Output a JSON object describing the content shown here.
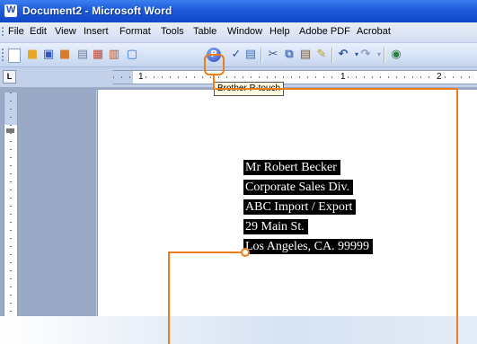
{
  "window": {
    "title": "Document2 - Microsoft Word"
  },
  "menu": [
    "File",
    "Edit",
    "View",
    "Insert",
    "Format",
    "Tools",
    "Table",
    "Window",
    "Help",
    "Adobe PDF",
    "Acrobat"
  ],
  "toolbar": {
    "icons": [
      "new-doc-icon",
      "open-icon",
      "save-icon",
      "permission-icon",
      "print-icon",
      "print-preview-icon",
      "research-icon",
      "brother-ptouch-icon",
      "spelling-icon",
      "research-book-icon",
      "cut-icon",
      "copy-icon",
      "paste-icon",
      "format-painter-icon",
      "undo-icon",
      "redo-icon",
      "hyperlink-icon"
    ],
    "tooltip": "Brother P-touch"
  },
  "ruler": {
    "numbers": [
      "1",
      "1",
      "2"
    ]
  },
  "document": {
    "address_lines": [
      "Mr Robert Becker",
      "Corporate Sales Div.",
      "ABC Import / Export",
      "29 Main St.",
      "Los Angeles, CA. 99999"
    ]
  },
  "colors": {
    "callout": "#ee7d1c",
    "titlebar": "#1d5ad9",
    "selection": "#000000"
  }
}
